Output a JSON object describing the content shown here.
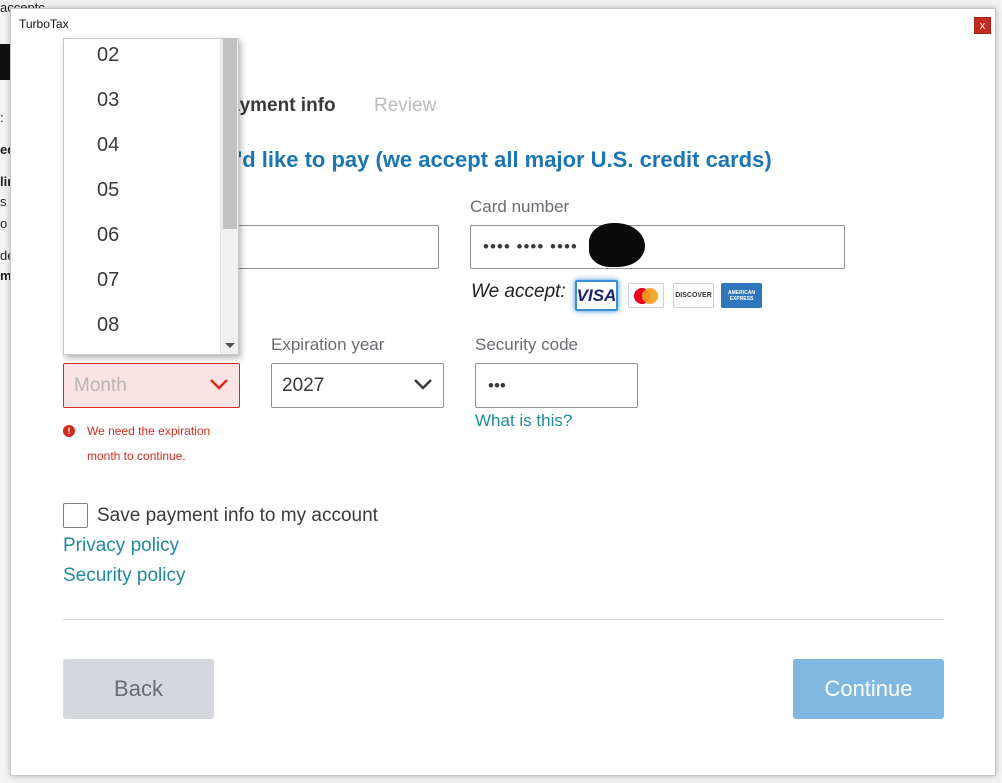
{
  "window": {
    "title": "TurboTax",
    "close_label": "x"
  },
  "background": {
    "frag_top": "acceptc",
    "frag_a": ":",
    "frag_b": "ed",
    "frag_c": "lir",
    "frag_d": "s fi",
    "frag_e": "o y",
    "frag_f": "de",
    "frag_g": "m"
  },
  "steps": {
    "payment": "ayment info",
    "review": "Review"
  },
  "heading": "'d like to pay (we accept all major U.S. credit cards)",
  "card_number": {
    "label": "Card number",
    "value": "•••• •••• ••••"
  },
  "we_accept": {
    "label": "We accept:",
    "cards": [
      {
        "name": "VISA",
        "color": "#1a1f71"
      },
      {
        "name": "MasterCard",
        "color": "#eb001b"
      },
      {
        "name": "DISCOVER",
        "color": "#f47216"
      },
      {
        "name": "AMERICAN EXPRESS",
        "color": "#2e77bc"
      }
    ]
  },
  "expiration_month": {
    "placeholder": "Month"
  },
  "expiration_year": {
    "label": "Expiration year",
    "value": "2027"
  },
  "security_code": {
    "label": "Security code",
    "value": "•••",
    "help_link": "What is this?"
  },
  "error": {
    "line1": "We need the expiration",
    "line2": "month to continue.",
    "icon": "!"
  },
  "save_payment": {
    "label": "Save payment info to my account",
    "checked": false
  },
  "links": {
    "privacy": "Privacy policy",
    "security": "Security policy"
  },
  "buttons": {
    "back": "Back",
    "continue": "Continue"
  },
  "month_dropdown": {
    "items": [
      "02",
      "03",
      "04",
      "05",
      "06",
      "07",
      "08"
    ]
  },
  "colors": {
    "accent": "#1b75b5",
    "error": "#d52b1e",
    "link": "#1f8a99",
    "continue_bg": "#7fb8e0"
  }
}
